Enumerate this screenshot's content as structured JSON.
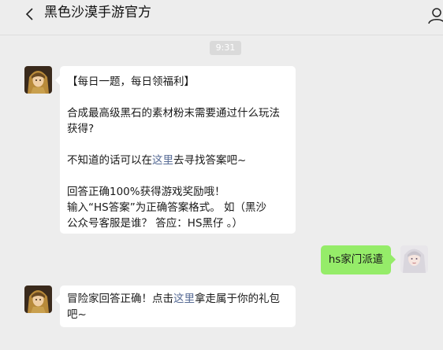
{
  "header": {
    "title": "黑色沙漠手游官方",
    "back_icon": "chevron-left-icon",
    "profile_icon": "person-icon"
  },
  "chat": {
    "timestamp": "9:31",
    "messages": [
      {
        "sender": "official",
        "lines": [
          "【每日一题，每日领福利】",
          "",
          "合成最高级黑石的素材粉末需要通过什么玩法",
          "获得?",
          "",
          "不知道的话可以在",
          "",
          "",
          "回答正确100%获得游戏奖励哦！",
          "输入“HS答案”为正确答案格式。 如（黑沙",
          "公众号客服是谁？ 答应：HS黑仔 。）"
        ],
        "q_line1": "【每日一题，每日领福利】",
        "q_line2": "合成最高级黑石的素材粉末需要通过什么玩法",
        "q_line3": "获得?",
        "hint_prefix": "不知道的话可以在",
        "hint_link": "这里",
        "hint_suffix": "去寻找答案吧~",
        "reward_line1": "回答正确100%获得游戏奖励哦！",
        "reward_line2": "输入“HS答案”为正确答案格式。 如（黑沙",
        "reward_line3": "公众号客服是谁？ 答应：HS黑仔 。）"
      },
      {
        "sender": "user",
        "text": "hs家门派遣"
      },
      {
        "sender": "official",
        "prefix": "冒险家回答正确！点击",
        "link": "这里",
        "suffix_line1": "拿走属于你的礼包",
        "suffix_line2": "吧~"
      }
    ]
  },
  "colors": {
    "background": "#ededed",
    "bubble_incoming": "#ffffff",
    "bubble_outgoing": "#95ec69",
    "link": "#576b95"
  }
}
